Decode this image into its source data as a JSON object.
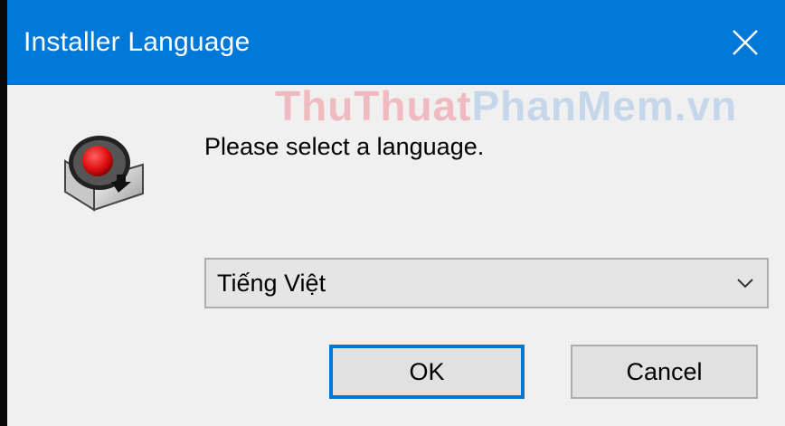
{
  "window": {
    "title": "Installer Language",
    "close_icon": "close-icon"
  },
  "watermark": {
    "part1": "ThuThuat",
    "part2": "PhanMem.vn"
  },
  "content": {
    "icon": "installer-icon",
    "prompt": "Please select a language.",
    "language_select": {
      "value": "Tiếng Việt",
      "icon": "chevron-down-icon"
    }
  },
  "buttons": {
    "ok_label": "OK",
    "cancel_label": "Cancel"
  },
  "colors": {
    "titlebar": "#0078d7",
    "focus_border": "#0078d7",
    "dialog_bg": "#f0f0f0"
  }
}
